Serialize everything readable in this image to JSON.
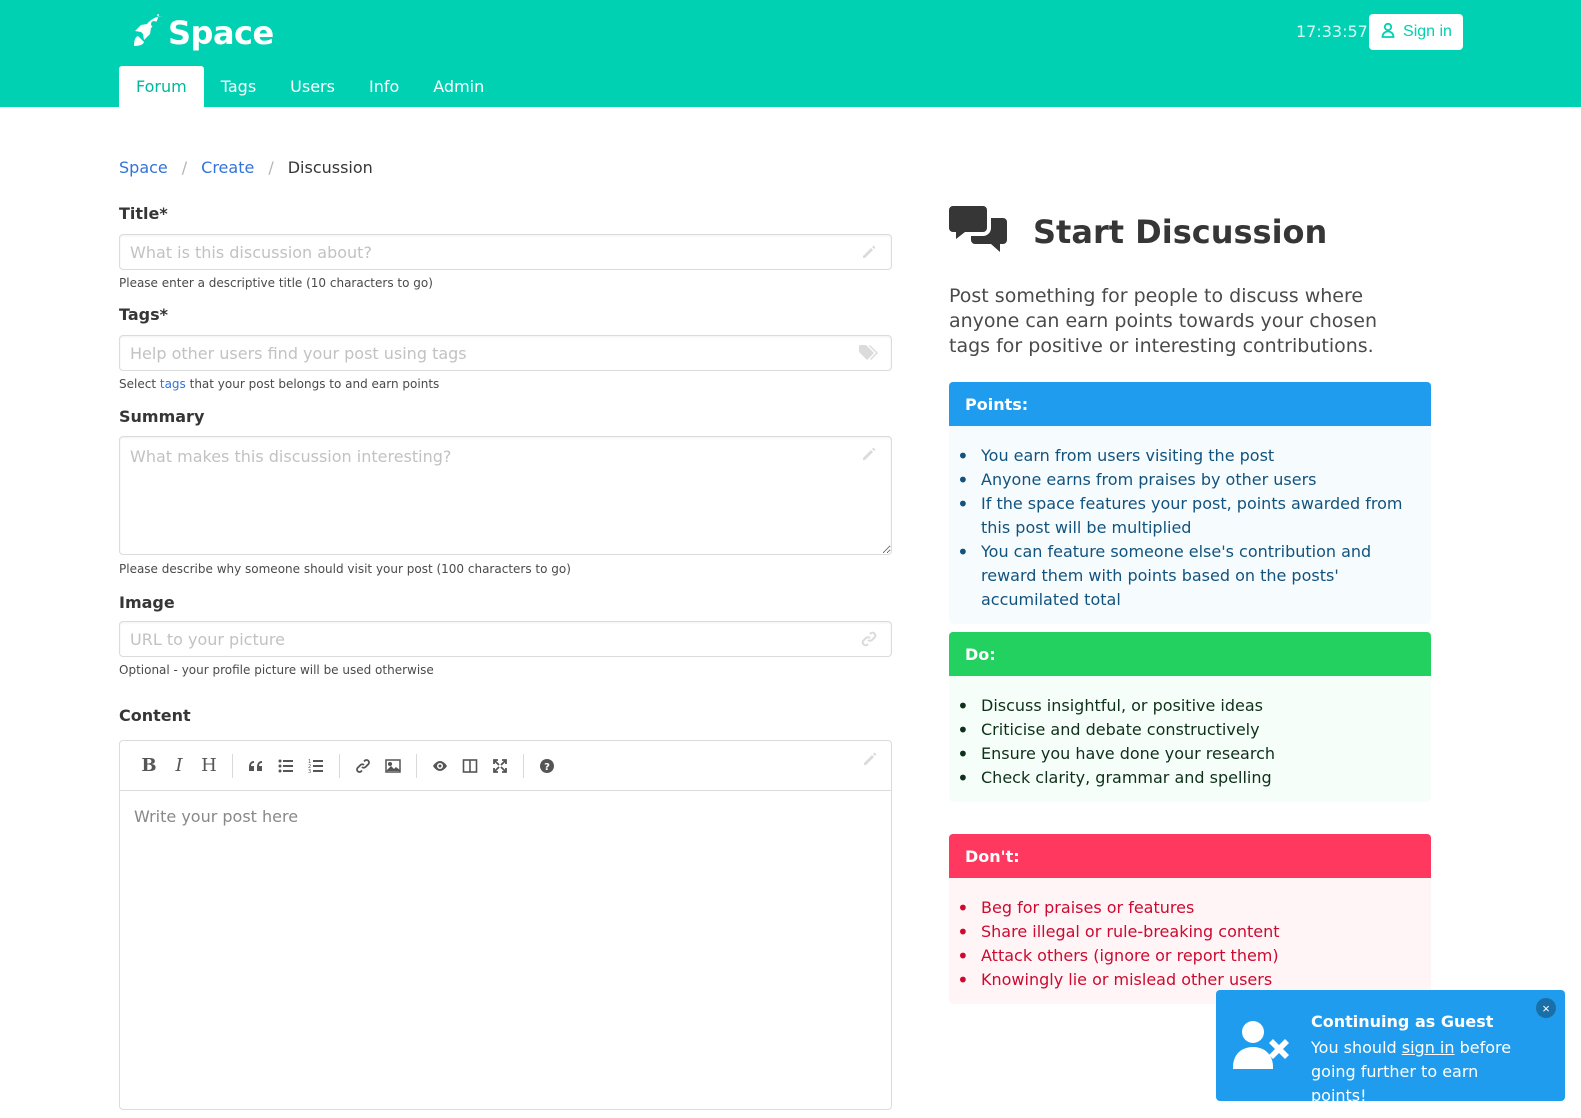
{
  "header": {
    "brand": "Space",
    "clock": "17:33:57",
    "signin_label": "Sign in",
    "tabs": [
      "Forum",
      "Tags",
      "Users",
      "Info",
      "Admin"
    ],
    "active_tab": "Forum"
  },
  "breadcrumb": {
    "items": [
      "Space",
      "Create"
    ],
    "current": "Discussion"
  },
  "form": {
    "title": {
      "label": "Title*",
      "placeholder": "What is this discussion about?",
      "help": "Please enter a descriptive title (10 characters to go)"
    },
    "tags": {
      "label": "Tags*",
      "placeholder": "Help other users find your post using tags",
      "help_prefix": "Select",
      "help_link": "tags",
      "help_suffix": "that your post belongs to and earn points"
    },
    "summary": {
      "label": "Summary",
      "placeholder": "What makes this discussion interesting?",
      "help": "Please describe why someone should visit your post (100 characters to go)"
    },
    "image": {
      "label": "Image",
      "placeholder": "URL to your picture",
      "help": "Optional - your profile picture will be used otherwise"
    },
    "content": {
      "label": "Content",
      "placeholder": "Write your post here",
      "toolbar": {
        "bold": "B",
        "italic": "I",
        "heading": "H"
      }
    }
  },
  "sidebar": {
    "title": "Start Discussion",
    "description": "Post something for people to discuss where anyone can earn points towards your chosen tags for positive or interesting contributions.",
    "points": {
      "header": "Points:",
      "items": [
        "You earn from users visiting the post",
        "Anyone earns from praises by other users",
        "If the space features your post, points awarded from this post will be multiplied",
        "You can feature someone else's contribution and reward them with points based on the posts' accumilated total"
      ]
    },
    "do": {
      "header": "Do:",
      "items": [
        "Discuss insightful, or positive ideas",
        "Criticise and debate constructively",
        "Ensure you have done your research",
        "Check clarity, grammar and spelling"
      ]
    },
    "dont": {
      "header": "Don't:",
      "items": [
        "Beg for praises or features",
        "Share illegal or rule-breaking content",
        "Attack others (ignore or report them)",
        "Knowingly lie or mislead other users"
      ]
    }
  },
  "toast": {
    "title": "Continuing as Guest",
    "text_prefix": "You should",
    "link": "sign in",
    "text_suffix": "before going further to earn points!",
    "close": "×"
  },
  "colors": {
    "primary": "#00d1b2",
    "link": "#3273dc",
    "info": "#209cee",
    "success": "#23d160",
    "danger": "#ff3860"
  },
  "icons": {
    "brand": "rocket-icon",
    "signin": "user-icon",
    "title_field": "pencil-icon",
    "tags_field": "tags-icon",
    "summary_field": "pencil-icon",
    "image_field": "link-icon",
    "sidebar": "comments-icon",
    "toast": "user-times-icon"
  }
}
